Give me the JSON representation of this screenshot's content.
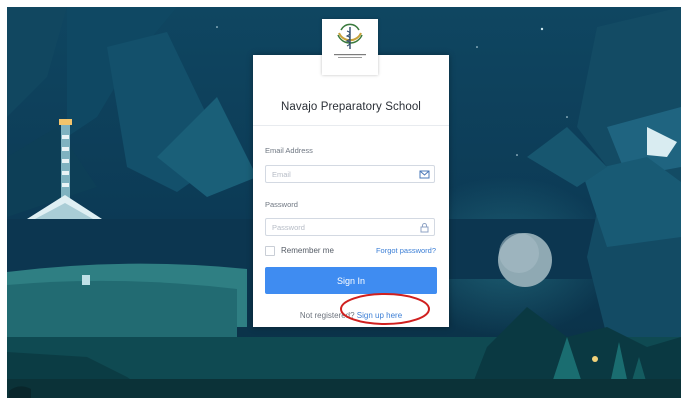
{
  "school": {
    "name": "Navajo Preparatory School",
    "logo_icon": "school-seal-logo-icon"
  },
  "login_form": {
    "email_label": "Email Address",
    "email_placeholder": "Email",
    "email_icon": "envelope-icon",
    "password_label": "Password",
    "password_placeholder": "Password",
    "password_icon": "lock-icon",
    "remember_label": "Remember me",
    "remember_checked": false,
    "forgot_label": "Forgot password?",
    "signin_label": "Sign In",
    "not_registered_text": "Not registered?",
    "signup_label": "Sign up here"
  },
  "colors": {
    "primary_button": "#3f8cf1",
    "link": "#3c7fd6",
    "annotation": "#d0201f",
    "background": "#0b3850"
  }
}
